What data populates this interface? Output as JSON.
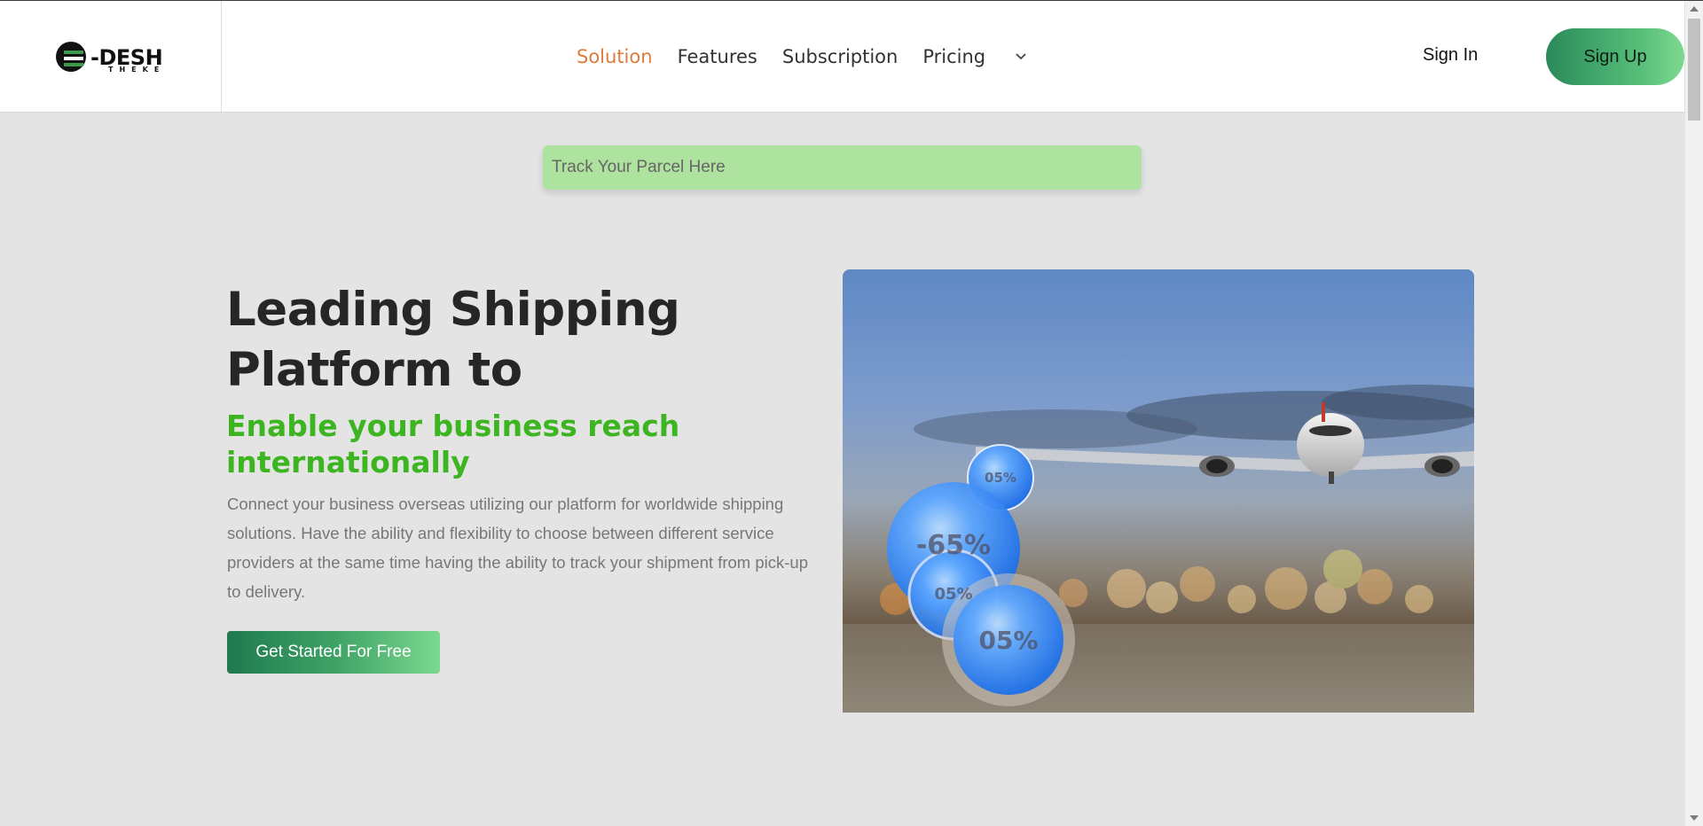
{
  "brand": {
    "logo_main": "-DESH",
    "logo_sub": "THEKE"
  },
  "nav": {
    "items": [
      {
        "label": "Solution",
        "active": true
      },
      {
        "label": "Features",
        "active": false
      },
      {
        "label": "Subscription",
        "active": false
      },
      {
        "label": "Pricing",
        "active": false
      }
    ],
    "dropdown_icon": "chevron-down-icon"
  },
  "auth": {
    "signin_label": "Sign In",
    "signup_label": "Sign Up"
  },
  "track": {
    "placeholder": "Track Your Parcel Here"
  },
  "hero": {
    "title": "Leading Shipping Platform to",
    "subtitle": "Enable your business reach internationally",
    "description": "Connect your business overseas utilizing our platform for worldwide shipping solutions. Have the ability and flexibility to choose between different service providers at the same time having the ability to track your shipment from pick-up to delivery.",
    "cta_label": "Get Started For Free"
  },
  "bubbles": {
    "small_top": "05%",
    "large": "-65%",
    "medium": "05%",
    "bottom": "05%"
  },
  "colors": {
    "accent_orange": "#e07b39",
    "green_subtitle": "#3cb521",
    "track_bg": "#aee29f",
    "page_bg": "#e4e4e4"
  }
}
